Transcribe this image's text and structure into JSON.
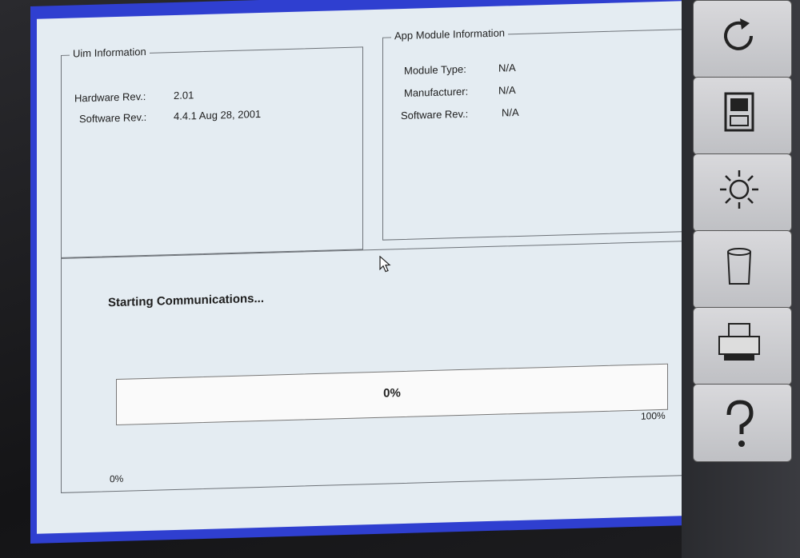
{
  "uim_info": {
    "title": "Uim Information",
    "hardware_label": "Hardware Rev.:",
    "hardware_value": "2.01",
    "software_label": "Software Rev.:",
    "software_value": "4.4.1 Aug 28, 2001"
  },
  "app_module_info": {
    "title": "App Module Information",
    "module_type_label": "Module Type:",
    "module_type_value": "N/A",
    "manufacturer_label": "Manufacturer:",
    "manufacturer_value": "N/A",
    "software_label": "Software Rev.:",
    "software_value": "N/A"
  },
  "status": {
    "message": "Starting Communications...",
    "progress_text": "0%",
    "progress_fraction": 0,
    "scale_max": "100%",
    "scale_min": "0%"
  },
  "colors": {
    "screen_background": "#e4ecf2",
    "frame_border": "#2f3fd0"
  },
  "side_buttons": [
    {
      "icon": "refresh-icon"
    },
    {
      "icon": "device-icon"
    },
    {
      "icon": "brightness-icon"
    },
    {
      "icon": "trash-icon"
    },
    {
      "icon": "printer-icon"
    },
    {
      "icon": "help-icon"
    }
  ]
}
